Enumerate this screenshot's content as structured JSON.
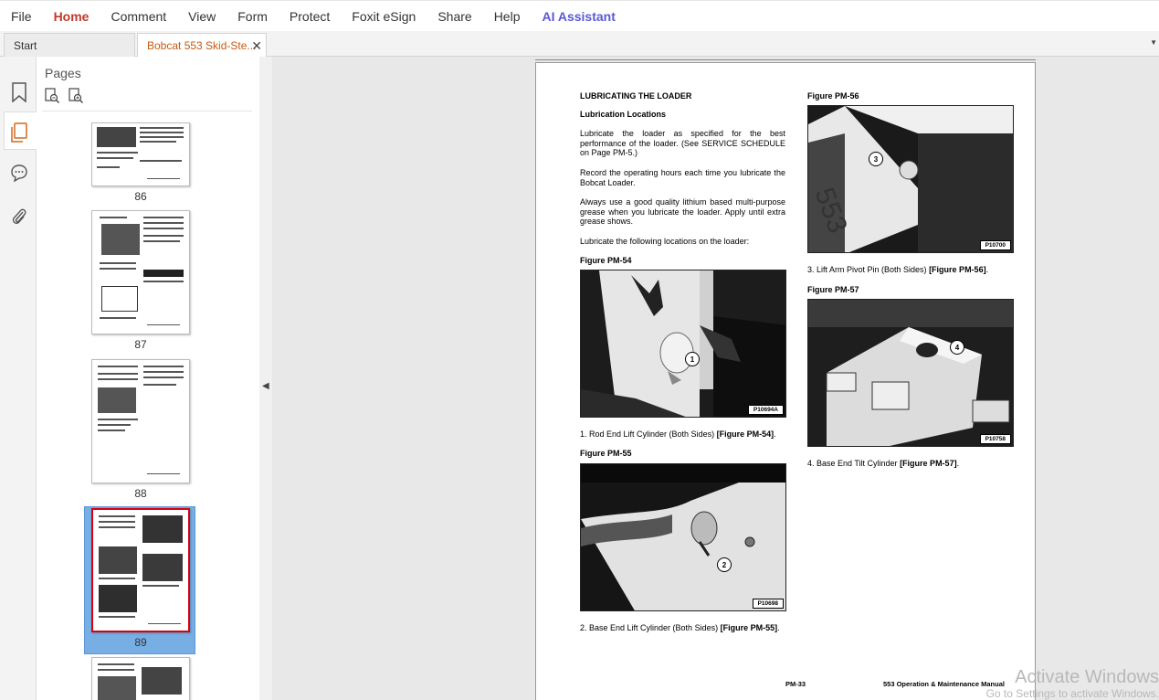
{
  "menubar": {
    "items": [
      "File",
      "Home",
      "Comment",
      "View",
      "Form",
      "Protect",
      "Foxit eSign",
      "Share",
      "Help",
      "AI Assistant"
    ]
  },
  "tabs": {
    "start_label": "Start",
    "doc_label": "Bobcat 553 Skid-Ste...",
    "close_glyph": "✕"
  },
  "panel": {
    "title": "Pages",
    "thumbs": [
      {
        "label": "86"
      },
      {
        "label": "87"
      },
      {
        "label": "88"
      },
      {
        "label": "89",
        "selected": true
      }
    ]
  },
  "page": {
    "heading": "LUBRICATING THE LOADER",
    "subheading": "Lubrication Locations",
    "para1": "Lubricate the loader as specified for the best performance of the loader. (See SERVICE SCHEDULE on Page PM-5.)",
    "para2": "Record the operating hours each time you lubricate the Bobcat Loader.",
    "para3": "Always use a good quality lithium based multi-purpose grease when you lubricate the loader. Apply until extra grease shows.",
    "para4": "Lubricate the following locations on the loader:",
    "fig54": {
      "title": "Figure PM-54",
      "tag": "P10694A",
      "callout": "1"
    },
    "item1": {
      "text": "1.   Rod End Lift Cylinder (Both Sides) ",
      "ref": "[Figure PM-54]",
      "end": "."
    },
    "fig55": {
      "title": "Figure PM-55",
      "tag": "P10698",
      "callout": "2"
    },
    "item2": {
      "text": "2.   Base End Lift Cylinder (Both Sides) ",
      "ref": "[Figure PM-55]",
      "end": "."
    },
    "fig56": {
      "title": "Figure PM-56",
      "tag": "P10700",
      "callout": "3"
    },
    "item3": {
      "text": "3.   Lift Arm Pivot Pin (Both Sides) ",
      "ref": "[Figure PM-56]",
      "end": "."
    },
    "fig57": {
      "title": "Figure PM-57",
      "tag": "P10758",
      "callout": "4"
    },
    "item4": {
      "text": "4.   Base End Tilt Cylinder ",
      "ref": "[Figure PM-57]",
      "end": "."
    },
    "footer_page": "PM-33",
    "footer_title": "553 Operation & Maintenance Manual"
  },
  "watermark": {
    "line1": "Activate Windows",
    "line2": "Go to Settings to activate Windows."
  }
}
